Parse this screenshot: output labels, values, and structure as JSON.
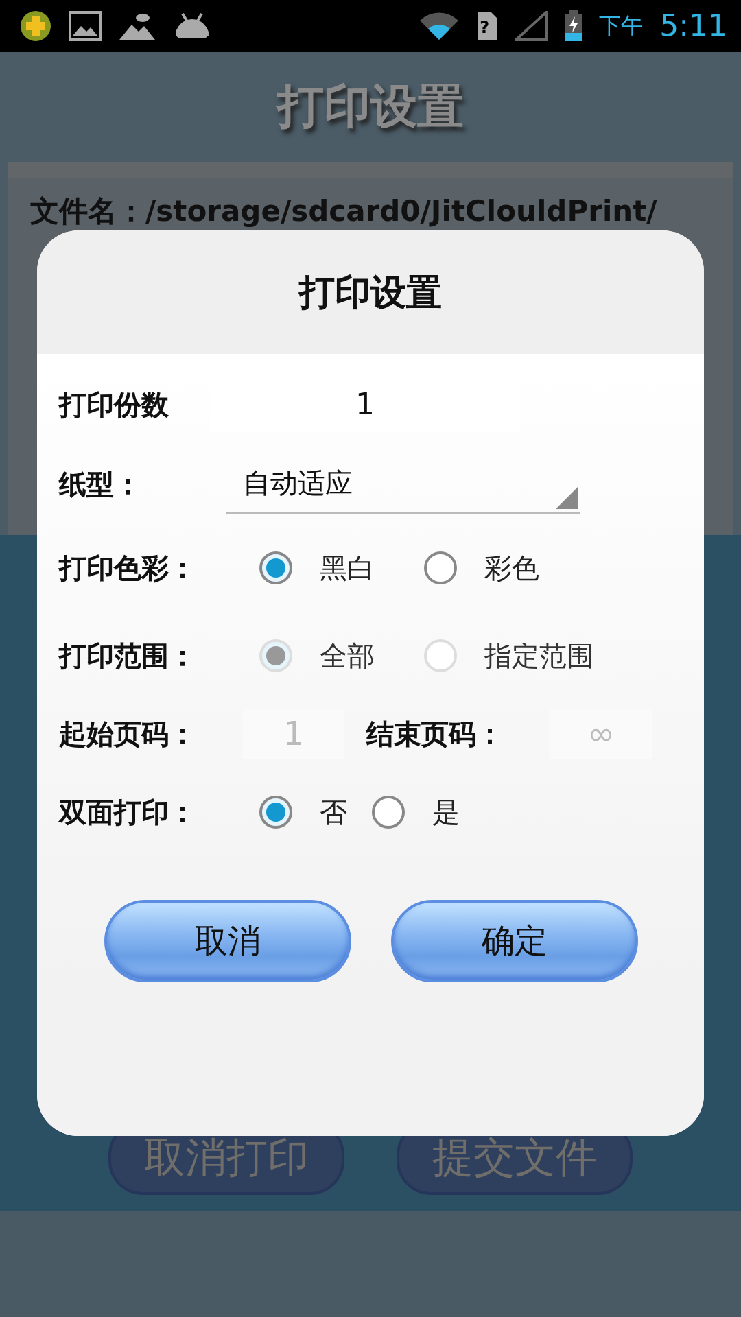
{
  "status_bar": {
    "sim_mark": "?",
    "period": "下午",
    "time": "5:11"
  },
  "background": {
    "title": "打印设置",
    "file_label": "文件名：/storage/sdcard0/JitClouldPrint/",
    "buttons": [
      "取消打印",
      "提交文件"
    ]
  },
  "dialog": {
    "title": "打印设置",
    "copies": {
      "label": "打印份数",
      "value": "1"
    },
    "paper": {
      "label": "纸型：",
      "value": "自动适应"
    },
    "color": {
      "label": "打印色彩：",
      "options": [
        {
          "label": "黑白",
          "selected": true,
          "disabled": false
        },
        {
          "label": "彩色",
          "selected": false,
          "disabled": false
        }
      ]
    },
    "range": {
      "label": "打印范围：",
      "options": [
        {
          "label": "全部",
          "selected": true,
          "disabled": true
        },
        {
          "label": "指定范围",
          "selected": false,
          "disabled": true
        }
      ]
    },
    "pages": {
      "start_label": "起始页码：",
      "start_value": "1",
      "end_label": "结束页码：",
      "end_value": "∞",
      "disabled": true
    },
    "duplex": {
      "label": "双面打印：",
      "options": [
        {
          "label": "否",
          "selected": true,
          "disabled": false
        },
        {
          "label": "是",
          "selected": false,
          "disabled": false
        }
      ]
    },
    "buttons": [
      "取消",
      "确定"
    ]
  }
}
